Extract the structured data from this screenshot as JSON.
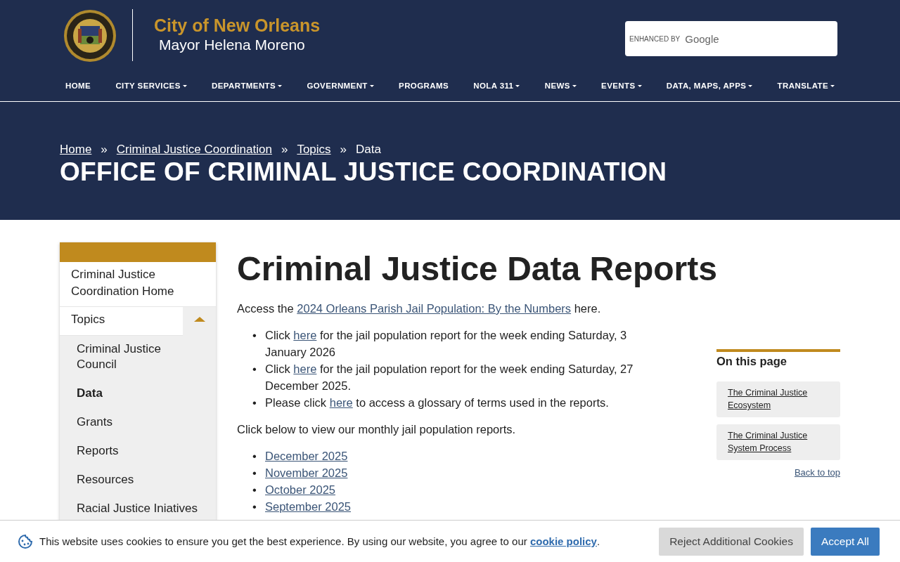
{
  "header": {
    "title": "City of New Orleans",
    "subtitle": "Mayor Helena Moreno",
    "search": {
      "brand_prefix": "ENHANCED BY",
      "brand": "Google"
    }
  },
  "nav": [
    {
      "label": "HOME",
      "dropdown": false
    },
    {
      "label": "CITY SERVICES",
      "dropdown": true
    },
    {
      "label": "DEPARTMENTS",
      "dropdown": true
    },
    {
      "label": "GOVERNMENT",
      "dropdown": true
    },
    {
      "label": "PROGRAMS",
      "dropdown": false
    },
    {
      "label": "NOLA 311",
      "dropdown": true
    },
    {
      "label": "NEWS",
      "dropdown": true
    },
    {
      "label": "EVENTS",
      "dropdown": true
    },
    {
      "label": "DATA, MAPS, APPS",
      "dropdown": true
    },
    {
      "label": "TRANSLATE",
      "dropdown": true
    }
  ],
  "breadcrumb": {
    "separator": "»",
    "items": [
      {
        "label": "Home",
        "link": true
      },
      {
        "label": "Criminal Justice Coordination",
        "link": true
      },
      {
        "label": "Topics",
        "link": true
      },
      {
        "label": "Data",
        "link": false
      }
    ]
  },
  "hero_title": "OFFICE OF CRIMINAL JUSTICE COORDINATION",
  "sidebar": {
    "items": [
      {
        "label": "Criminal Justice Coordination Home"
      },
      {
        "label": "Topics",
        "expanded": true,
        "children": [
          {
            "label": "Criminal Justice Council",
            "selected": false
          },
          {
            "label": "Data",
            "selected": true
          },
          {
            "label": "Grants",
            "selected": false
          },
          {
            "label": "Reports",
            "selected": false
          },
          {
            "label": "Resources",
            "selected": false
          },
          {
            "label": "Racial Justice Iniatives",
            "selected": false
          }
        ]
      }
    ]
  },
  "main": {
    "title": "Criminal Justice Data Reports",
    "bullet_marker": "•",
    "intro": {
      "before": "Access the ",
      "link": "2024 Orleans Parish Jail Population: By the Numbers",
      "after": " here."
    },
    "bullets": [
      {
        "before": "Click ",
        "link": "here",
        "after": " for the jail population report for the week ending Saturday, 3 January 2026"
      },
      {
        "before": "Click ",
        "link": "here",
        "after": " for the jail population report for the week ending Saturday, 27 December 2025."
      },
      {
        "before": "Please click ",
        "link": "here",
        "after": " to access a glossary of terms used in the reports."
      }
    ],
    "monthly_intro": "Click below to view our monthly jail population reports.",
    "monthly_links": [
      "December 2025",
      "November 2025",
      "October 2025",
      "September 2025"
    ]
  },
  "on_this_page": {
    "title": "On this page",
    "links": [
      "The Criminal Justice Ecosystem",
      "The Criminal Justice System Process"
    ],
    "back_to_top": "Back to top"
  },
  "cookie_banner": {
    "text": "This website uses cookies to ensure you get the best experience. By using our website, you agree to our ",
    "link": "cookie policy",
    "after": ".",
    "buttons": [
      {
        "label": "Reject Additional Cookies",
        "kind": "secondary"
      },
      {
        "label": "Accept All",
        "kind": "primary"
      }
    ]
  }
}
